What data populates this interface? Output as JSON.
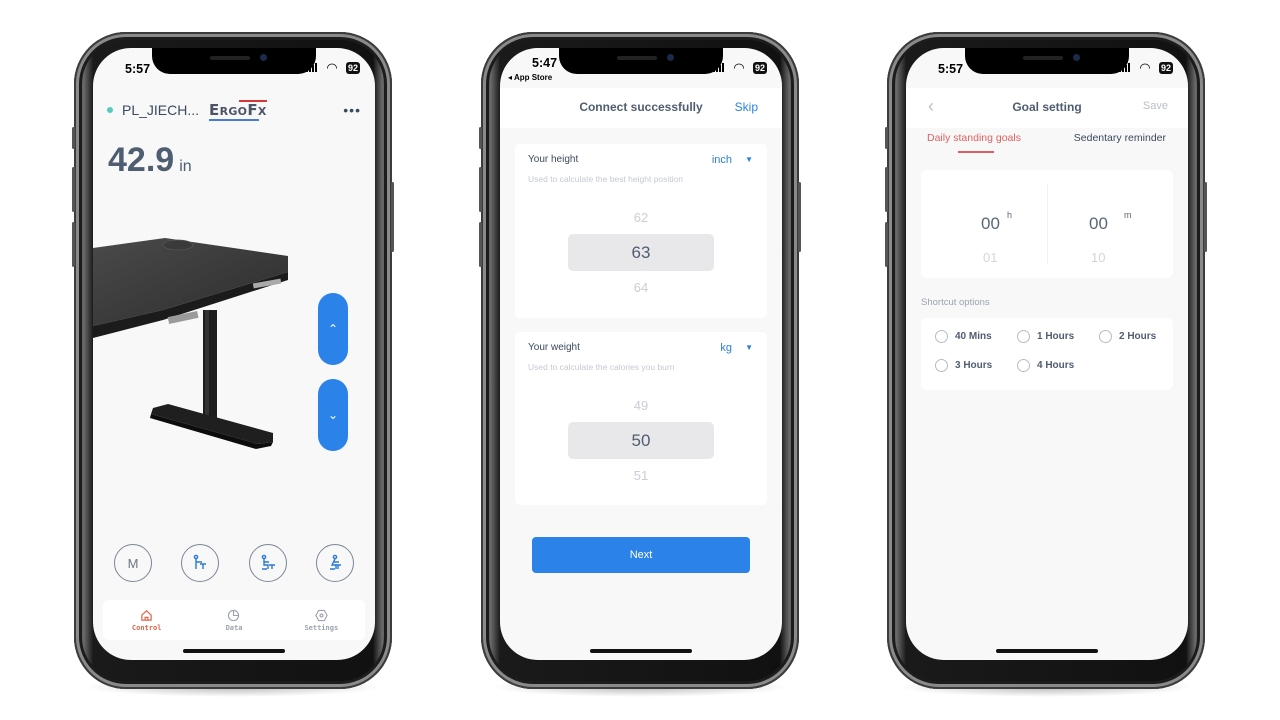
{
  "phones": [
    {
      "status": {
        "time": "5:57",
        "battery": "92"
      },
      "header": {
        "device_name": "PL_JIECH...",
        "brand_logo": "ErgoFx",
        "more_icon": "more-horizontal-icon"
      },
      "height": {
        "value": "42.9",
        "unit": "in"
      },
      "controls": {
        "up_icon": "chevron-up-icon",
        "down_icon": "chevron-down-icon"
      },
      "presets": [
        {
          "label": "M",
          "icon": "memory-preset"
        },
        {
          "label": "",
          "icon": "standing-preset-icon"
        },
        {
          "label": "",
          "icon": "sitting-preset-icon"
        },
        {
          "label": "",
          "icon": "sitting-low-preset-icon"
        }
      ],
      "tabbar": [
        {
          "label": "Control",
          "icon": "home-icon",
          "active": true
        },
        {
          "label": "Data",
          "icon": "pie-chart-icon",
          "active": false
        },
        {
          "label": "Settings",
          "icon": "hexagon-gear-icon",
          "active": false
        }
      ]
    },
    {
      "status": {
        "time": "5:47",
        "battery": "92",
        "back_app": "◂ App Store"
      },
      "nav": {
        "title": "Connect successfully",
        "skip": "Skip"
      },
      "height_card": {
        "label": "Your height",
        "unit": "inch",
        "description": "Used to calculate the best height position",
        "prev": "62",
        "selected": "63",
        "next": "64"
      },
      "weight_card": {
        "label": "Your weight",
        "unit": "kg",
        "description": "Used to calculate the calories you burn",
        "prev": "49",
        "selected": "50",
        "next": "51"
      },
      "next_button": "Next"
    },
    {
      "status": {
        "time": "5:57",
        "battery": "92"
      },
      "nav": {
        "back_icon": "‹",
        "title": "Goal setting",
        "save": "Save"
      },
      "tabs": [
        {
          "label": "Daily standing goals",
          "active": true
        },
        {
          "label": "Sedentary reminder",
          "active": false
        }
      ],
      "time_picker": {
        "hours": "00",
        "hours_unit": "h",
        "hours_next": "01",
        "minutes": "00",
        "minutes_unit": "m",
        "minutes_next": "10"
      },
      "shortcut_label": "Shortcut options",
      "shortcuts": [
        "40 Mins",
        "1 Hours",
        "2 Hours",
        "3 Hours",
        "4 Hours"
      ]
    }
  ],
  "colors": {
    "accent_blue": "#2b82e8",
    "active_red": "#e06060",
    "tab_active": "#e1644a",
    "online_dot": "#5cc9c0"
  }
}
